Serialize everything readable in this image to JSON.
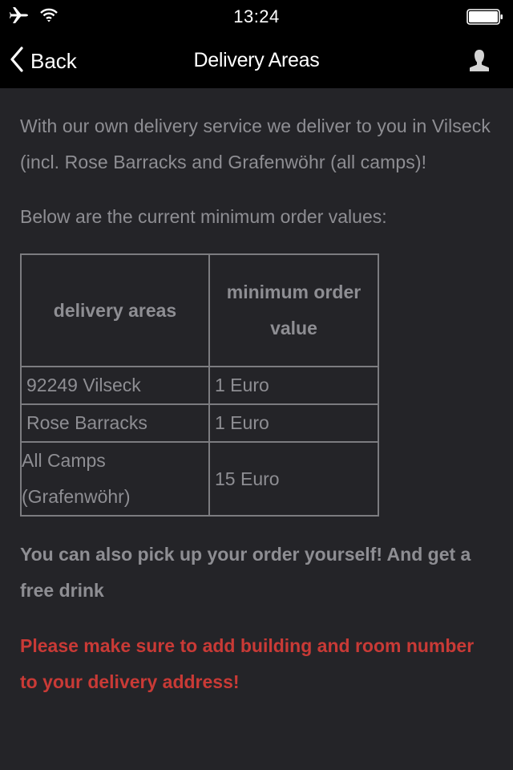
{
  "status_bar": {
    "time": "13:24",
    "icons": [
      "airplane-mode-icon",
      "wifi-icon",
      "battery-icon"
    ],
    "battery_level": 1.0
  },
  "nav": {
    "back_label": "Back",
    "title": "Delivery Areas",
    "right_icon": "profile-icon"
  },
  "content": {
    "intro": "With our own delivery service we deliver to you in Vilseck (incl. Rose Barracks and Grafenwöhr (all camps)!",
    "below": "Below are the current minimum order values:",
    "table": {
      "headers": [
        "delivery areas",
        "minimum order value"
      ],
      "rows": [
        {
          "area": "92249 Vilseck",
          "value": "1 Euro"
        },
        {
          "area": "Rose Barracks",
          "value": "1 Euro"
        },
        {
          "area": "All Camps (Grafenwöhr)",
          "value": "15 Euro"
        }
      ]
    },
    "pickup": "You can also pick up your order yourself! And get a free drink",
    "warning": "Please make sure to add building and room number to your delivery address!"
  },
  "colors": {
    "background": "#242428",
    "bar_background": "#000000",
    "text_gray": "#8e8e93",
    "warning_red": "#c93a36",
    "table_border": "#7c7c80"
  }
}
